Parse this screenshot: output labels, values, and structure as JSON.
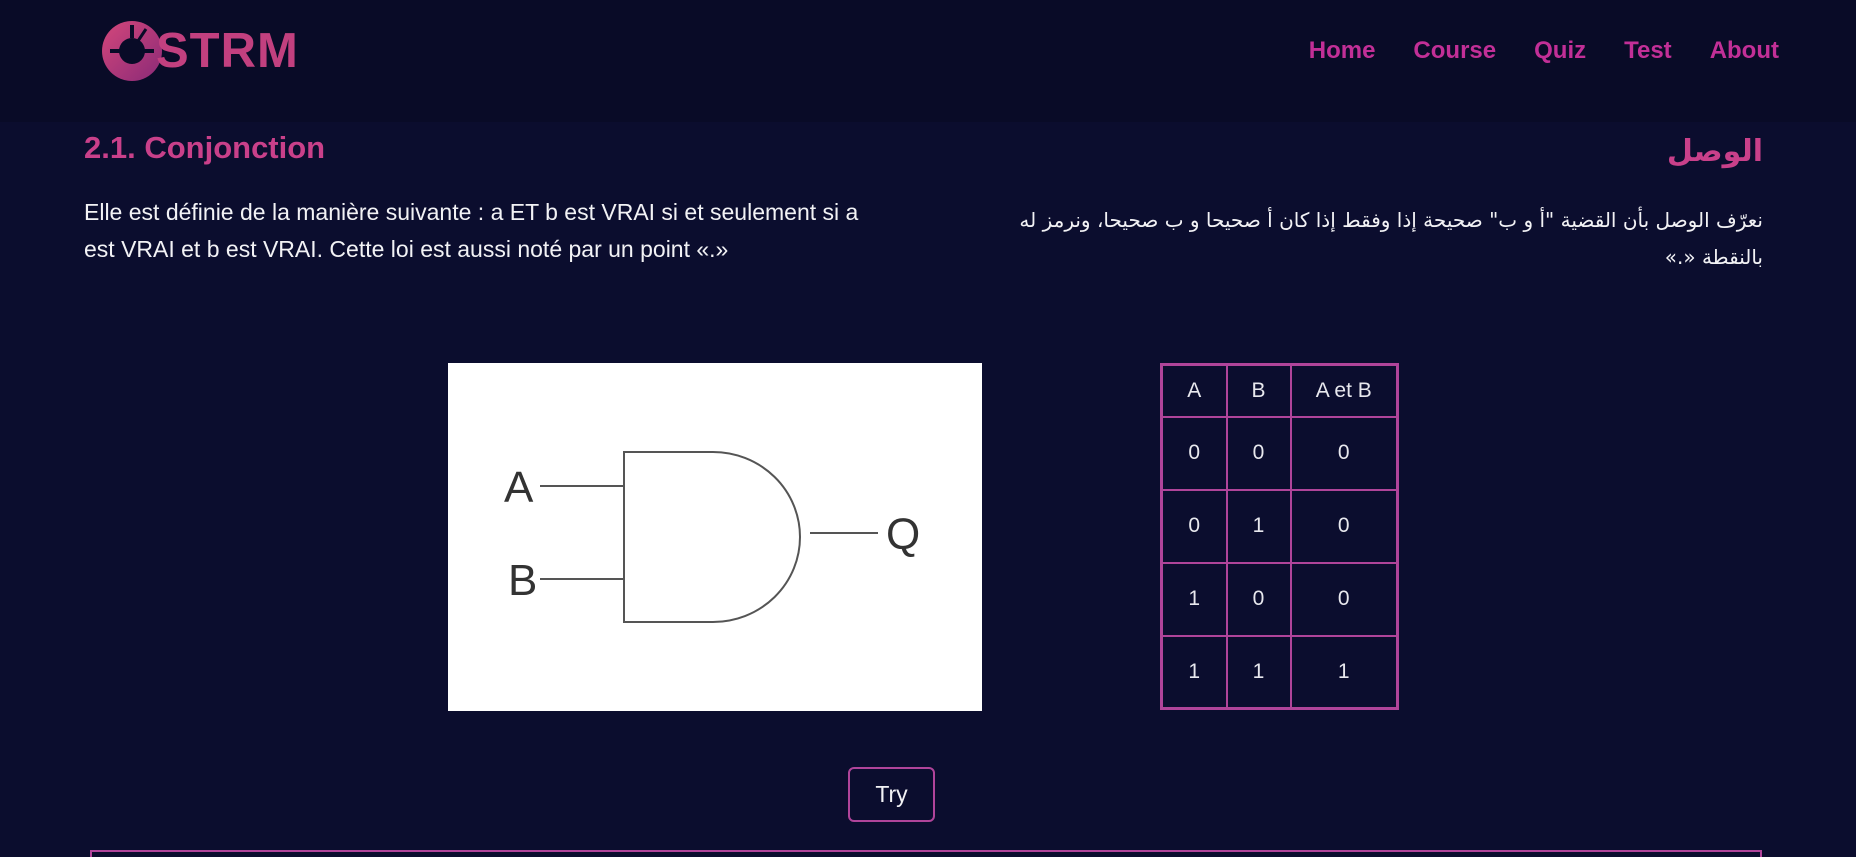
{
  "brand": {
    "name": "STRM",
    "color": "#c2407f"
  },
  "nav": [
    "Home",
    "Course",
    "Quiz",
    "Test",
    "About"
  ],
  "section": {
    "title_fr": "2.1. Conjonction",
    "title_ar": "الوصل",
    "text_fr": "Elle est définie de la manière suivante : a ET b est VRAI si et seulement si a est VRAI et b est VRAI. Cette loi est aussi noté par un point «.»",
    "text_ar": "نعرّف الوصل بأن القضية \"أ و ب\" صحيحة إذا وفقط إذا كان أ صحيحا و ب صحيحا، ونرمز له بالنقطة «.»"
  },
  "gate": {
    "input_a": "A",
    "input_b": "B",
    "output": "Q"
  },
  "truth_table": {
    "headers": [
      "A",
      "B",
      "A et B"
    ],
    "rows": [
      [
        "0",
        "0",
        "0"
      ],
      [
        "0",
        "1",
        "0"
      ],
      [
        "1",
        "0",
        "0"
      ],
      [
        "1",
        "1",
        "1"
      ]
    ]
  },
  "try_label": "Try",
  "colors": {
    "background": "#0b0d2e",
    "header": "#090b27",
    "accent": "#c9408a",
    "nav": "#c22f97",
    "border": "#b0449a"
  }
}
